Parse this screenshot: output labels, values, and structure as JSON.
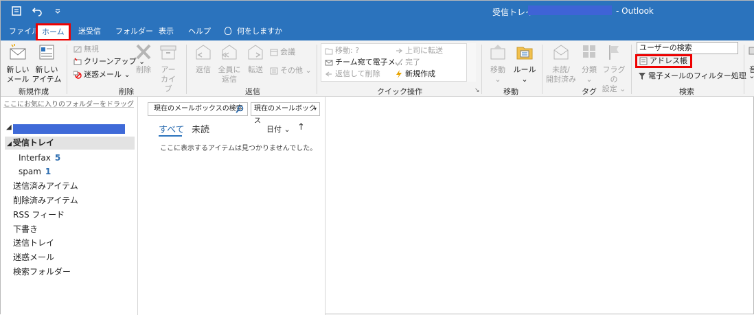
{
  "window": {
    "title": "受信トレイ - ",
    "app": "- Outlook"
  },
  "tabs": [
    {
      "label": "ファイル"
    },
    {
      "label": "ホーム"
    },
    {
      "label": "送受信"
    },
    {
      "label": "フォルダー"
    },
    {
      "label": "表示"
    },
    {
      "label": "ヘルプ"
    },
    {
      "label": "何をしますか"
    }
  ],
  "ribbon": {
    "new": {
      "new_mail": [
        "新しい",
        "メール"
      ],
      "new_items": [
        "新しい",
        "アイテム ⌄"
      ],
      "group": "新規作成"
    },
    "delete": {
      "ignore": "無視",
      "cleanup": "クリーンアップ ⌄",
      "junk": "迷惑メール ⌄",
      "delete": "削除",
      "archive": [
        "アー",
        "カイブ"
      ],
      "group": "削除"
    },
    "respond": {
      "reply": "返信",
      "reply_all": [
        "全員に",
        "返信"
      ],
      "forward": "転送",
      "meeting": "会議",
      "more": "その他 ⌄",
      "group": "返信"
    },
    "quick_steps": {
      "items": [
        "移動: ?",
        "チーム宛て電子メ...",
        "返信して削除",
        "上司に転送",
        "完了",
        "新規作成"
      ],
      "group": "クイック操作"
    },
    "move": {
      "move": [
        "移動",
        "⌄"
      ],
      "rules": [
        "ルール",
        "⌄"
      ],
      "group": "移動"
    },
    "tags": {
      "unread": [
        "未読/",
        "開封済み"
      ],
      "categorize": [
        "分類",
        "⌄"
      ],
      "followup": [
        "フラグの",
        "設定 ⌄"
      ],
      "group": "タグ"
    },
    "find": {
      "search_people": "ユーザーの検索",
      "address_book": "アドレス帳",
      "filter_email": "電子メールのフィルター処理 ⌄",
      "group": "検索"
    }
  },
  "folders": {
    "drop_hint": "ここにお気に入りのフォルダーをドラッグしま",
    "inbox": "受信トレイ",
    "subfolders": [
      {
        "name": "Interfax",
        "count": "5"
      },
      {
        "name": "spam",
        "count": "1"
      }
    ],
    "others": [
      "送信済みアイテム",
      "削除済みアイテム",
      "RSS フィード",
      "下書き",
      "送信トレイ",
      "迷惑メール",
      "検索フォルダー"
    ]
  },
  "message_list": {
    "search_placeholder": "現在のメールボックスの検索",
    "scope": "現在のメールボックス",
    "filter_all": "すべて",
    "filter_unread": "未読",
    "sort_by": "日付 ⌄",
    "sort_dir": "↑",
    "empty_text": "ここに表示するアイテムは見つかりませんでした。"
  }
}
